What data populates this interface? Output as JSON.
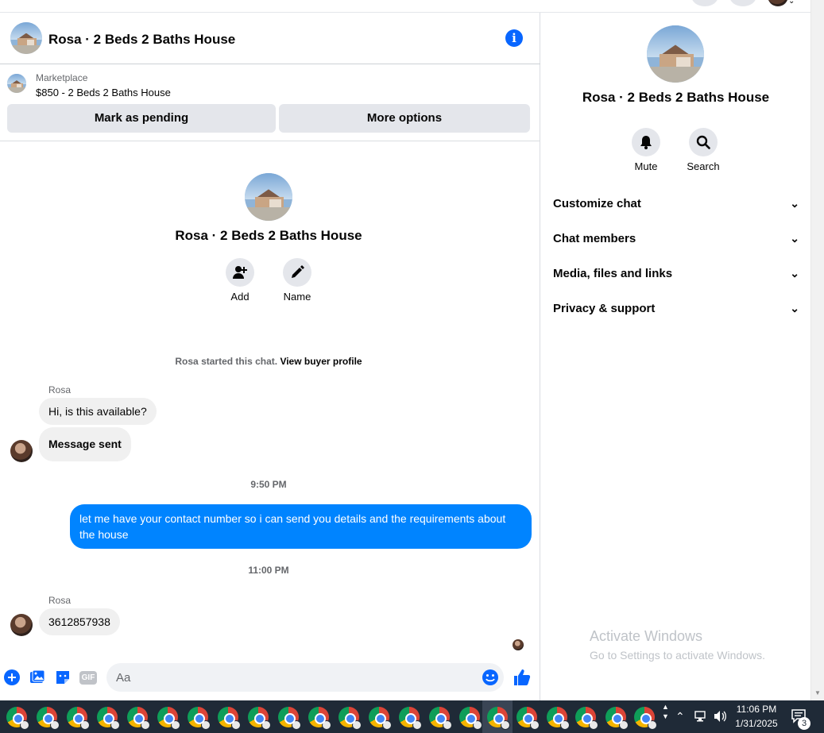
{
  "chat": {
    "title": "Rosa · 2 Beds 2 Baths House",
    "listing": {
      "source": "Marketplace",
      "price_title": "$850 - 2 Beds 2 Baths House"
    },
    "buttons": {
      "mark_pending": "Mark as pending",
      "more_options": "More options"
    },
    "intro": {
      "title": "Rosa · 2 Beds 2 Baths House",
      "add_label": "Add",
      "name_label": "Name"
    },
    "started_text": "Rosa started this chat.",
    "view_buyer_profile": "View buyer profile",
    "messages": [
      {
        "sender": "Rosa",
        "text": "Hi, is this available?"
      },
      {
        "text": "Message sent"
      },
      {
        "time": "9:50 PM"
      },
      {
        "text": "let me have your contact number so i can send you details and the requirements about the house"
      },
      {
        "time": "11:00 PM"
      },
      {
        "sender": "Rosa",
        "text": "3612857938"
      }
    ],
    "composer": {
      "placeholder": "Aa",
      "gif_label": "GIF"
    }
  },
  "right_panel": {
    "title": "Rosa · 2 Beds 2 Baths House",
    "actions": {
      "mute": "Mute",
      "search": "Search"
    },
    "sections": [
      "Customize chat",
      "Chat members",
      "Media, files and links",
      "Privacy & support"
    ]
  },
  "watermark": {
    "line1": "Activate Windows",
    "line2": "Go to Settings to activate Windows."
  },
  "taskbar": {
    "time": "11:06 PM",
    "date": "1/31/2025",
    "notifications": "3"
  },
  "colors": {
    "accent": "#0866ff",
    "outgoing_bubble": "#0084ff",
    "incoming_bubble": "#f0f0f0",
    "button_grey": "#e4e6eb"
  }
}
